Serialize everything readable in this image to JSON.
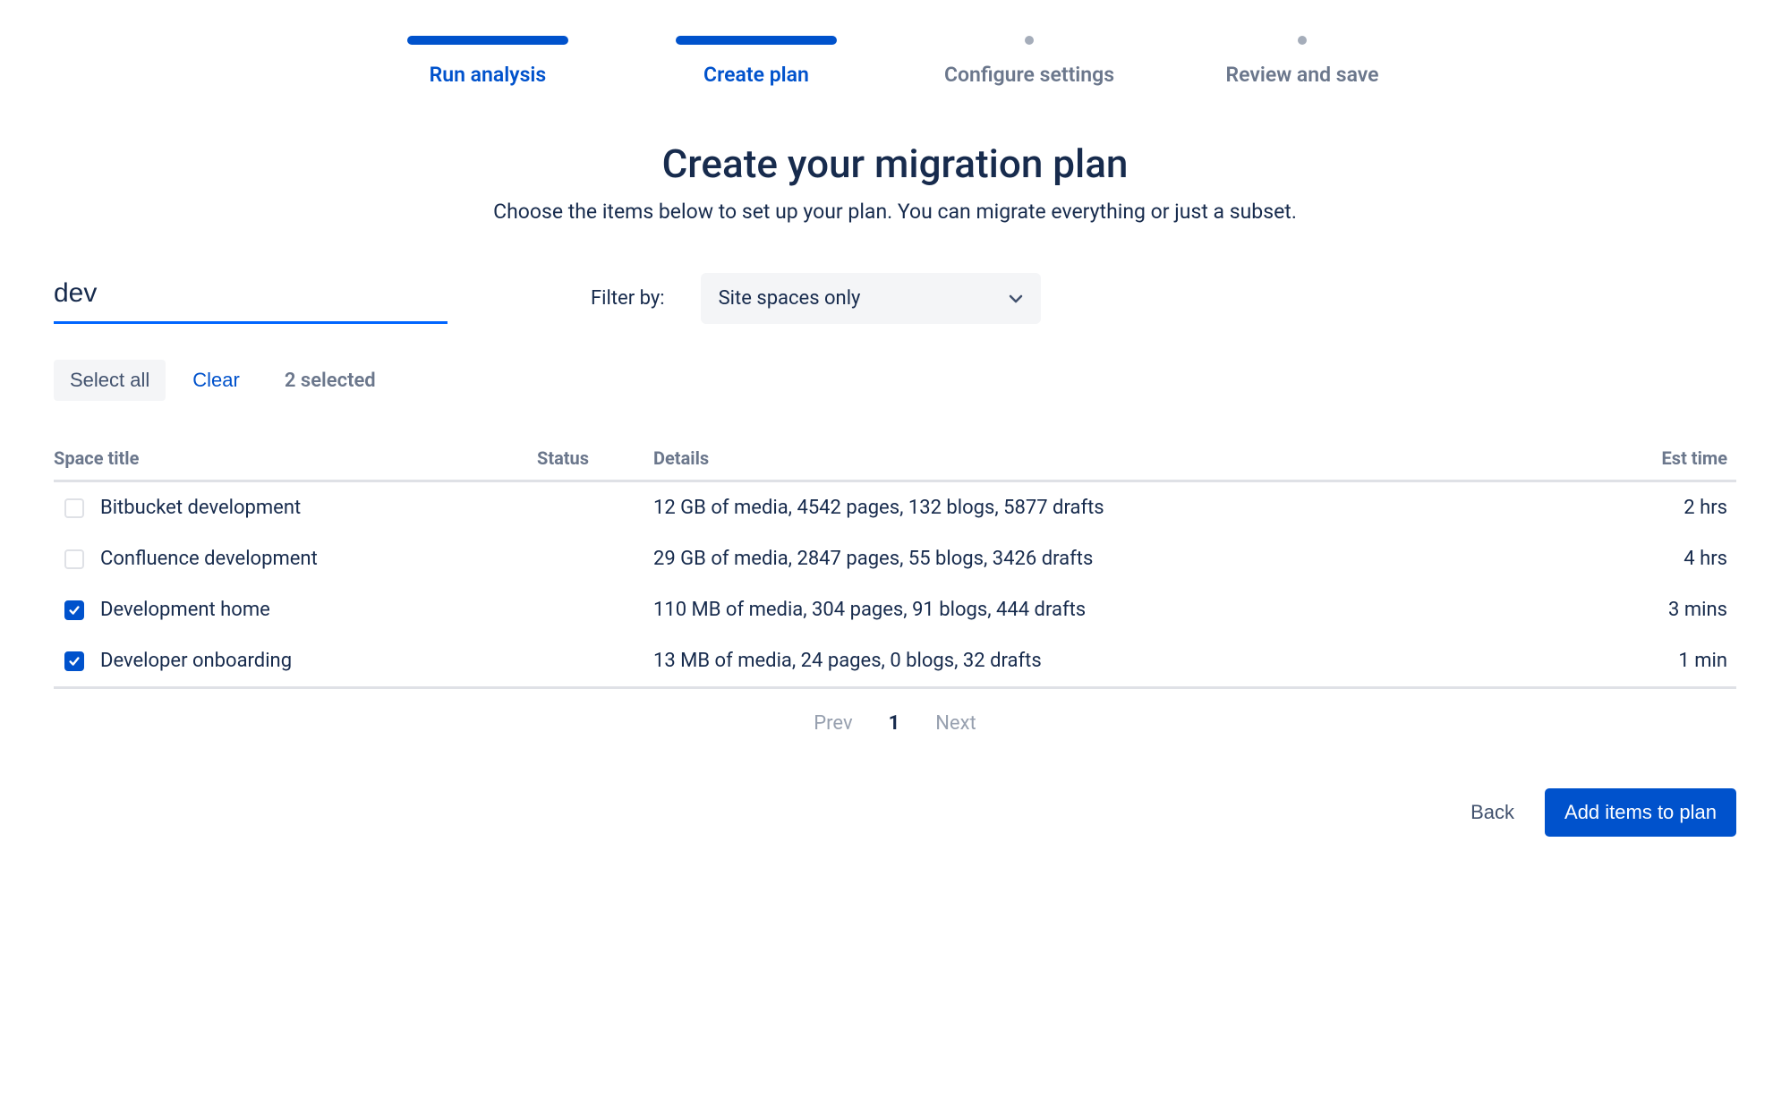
{
  "stepper": {
    "steps": [
      {
        "label": "Run analysis",
        "state": "done"
      },
      {
        "label": "Create plan",
        "state": "active"
      },
      {
        "label": "Configure settings",
        "state": "pending"
      },
      {
        "label": "Review and save",
        "state": "pending"
      }
    ]
  },
  "header": {
    "title": "Create your migration plan",
    "subtitle": "Choose the items below to set up your plan. You can migrate everything or just a subset."
  },
  "filters": {
    "search_value": "dev",
    "filter_by_label": "Filter by:",
    "dropdown_value": "Site spaces only"
  },
  "actions": {
    "select_all": "Select all",
    "clear": "Clear",
    "selected_text": "2 selected"
  },
  "table": {
    "columns": {
      "title": "Space title",
      "status": "Status",
      "details": "Details",
      "est": "Est time"
    },
    "rows": [
      {
        "checked": false,
        "title": "Bitbucket development",
        "status": "",
        "details": "12 GB of media, 4542 pages, 132 blogs, 5877 drafts",
        "est": "2 hrs"
      },
      {
        "checked": false,
        "title": "Confluence development",
        "status": "",
        "details": "29 GB of media, 2847 pages, 55 blogs, 3426 drafts",
        "est": "4 hrs"
      },
      {
        "checked": true,
        "title": "Development home",
        "status": "",
        "details": "110 MB of media, 304 pages, 91 blogs, 444 drafts",
        "est": "3 mins"
      },
      {
        "checked": true,
        "title": "Developer onboarding",
        "status": "",
        "details": "13 MB of media, 24 pages, 0 blogs, 32 drafts",
        "est": "1 min"
      }
    ]
  },
  "pagination": {
    "prev": "Prev",
    "current": "1",
    "next": "Next"
  },
  "footer": {
    "back": "Back",
    "add": "Add items to plan"
  }
}
